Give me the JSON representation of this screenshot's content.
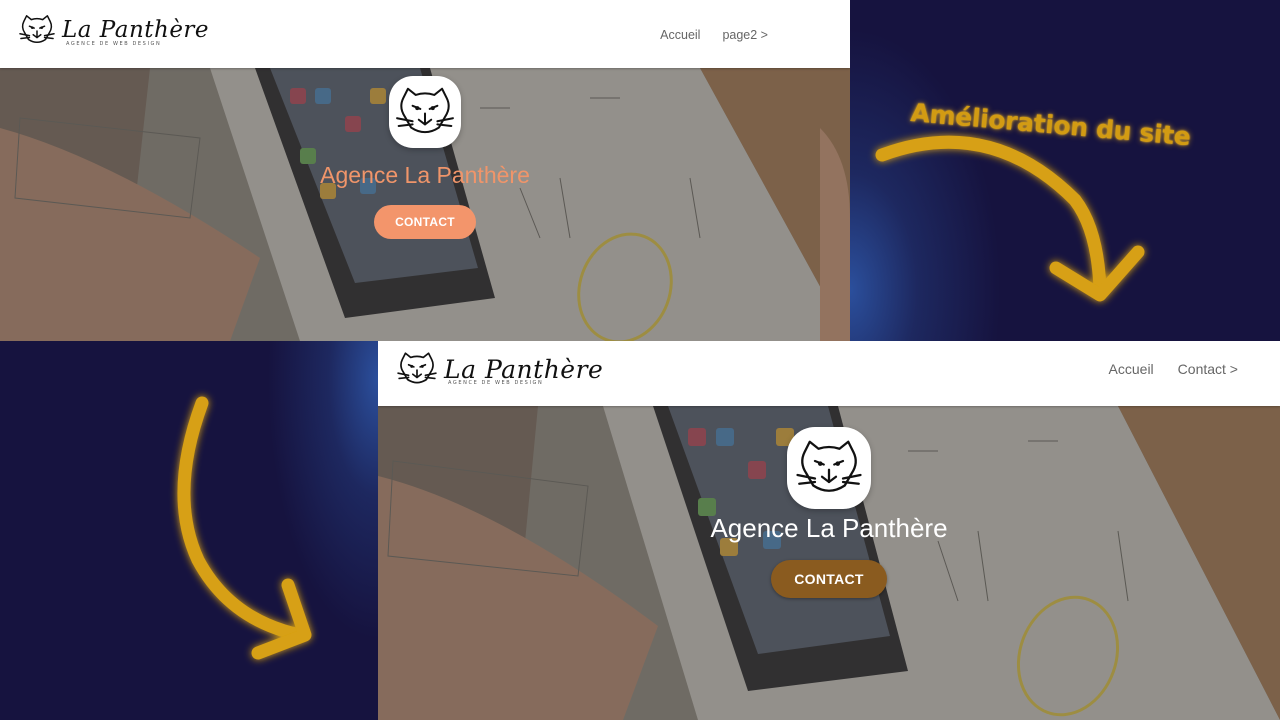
{
  "before_site": {
    "brand": {
      "name": "La Panthère",
      "tagline": "AGENCE DE WEB DESIGN"
    },
    "nav": [
      {
        "label": "Accueil"
      },
      {
        "label": "page2 >"
      }
    ],
    "hero": {
      "title": "Agence La Panthère",
      "cta_label": "CONTACT"
    }
  },
  "after_site": {
    "brand": {
      "name": "La Panthère",
      "tagline": "AGENCE DE WEB DESIGN"
    },
    "nav": [
      {
        "label": "Accueil"
      },
      {
        "label": "Contact >"
      }
    ],
    "hero": {
      "title": "Agence La Panthère",
      "cta_label": "CONTACT"
    }
  },
  "annotation": {
    "text": "Amélioration du site"
  },
  "colors": {
    "background": "#16133f",
    "before_accent": "#f3956b",
    "after_cta": "#8a5b1f",
    "annotation": "#d29b13"
  },
  "icons": {
    "logo": "panther-head-icon",
    "arrow": "curved-arrow-icon"
  }
}
